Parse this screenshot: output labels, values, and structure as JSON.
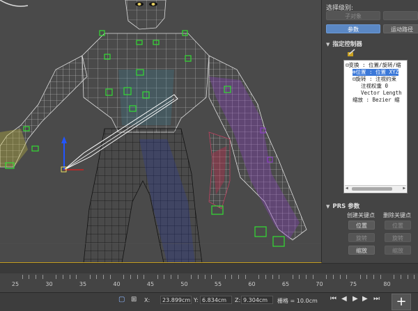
{
  "panel": {
    "select_level_label": "选择级别:",
    "sub_object_button": "子对象",
    "tab_params": "参数",
    "tab_motion_path": "运动路径",
    "assign_controller_title": "指定控制器",
    "assign_icon": "assign-controller-icon"
  },
  "controller_tree": {
    "items": [
      {
        "label": "⊟变换 : 位置/旋转/缩",
        "selected": false
      },
      {
        "label": "⊕位置 : 位置 XYZ",
        "selected": true
      },
      {
        "label": "⊟旋转 : 注视约束",
        "selected": false
      },
      {
        "label": "注视权重 0",
        "selected": false
      },
      {
        "label": "Vector Length",
        "selected": false
      },
      {
        "label": "缩放 : Bezier 缩",
        "selected": false
      }
    ]
  },
  "prs": {
    "title": "PRS 参数",
    "create_key_label": "创建关键点",
    "delete_key_label": "删除关键点",
    "create_position": "位置",
    "create_rotation": "旋转",
    "create_scale": "缩放",
    "delete_position": "位置",
    "delete_rotation": "旋转",
    "delete_scale": "缩放"
  },
  "timeline": {
    "ticks": [
      "25",
      "30",
      "35",
      "40",
      "45",
      "50",
      "55",
      "60",
      "65",
      "70",
      "75",
      "80"
    ]
  },
  "status": {
    "x_label": "X:",
    "x_value": "23.899cm",
    "y_label": "Y:",
    "y_value": "6.834cm",
    "z_label": "Z:",
    "z_value": "9.304cm",
    "grid_text": "栅格 = 10.0cm",
    "add_key_label": "+"
  },
  "colors": {
    "accent": "#5b88c4",
    "selection_yellow": "#c8a020",
    "bone_green": "#33dd33"
  }
}
